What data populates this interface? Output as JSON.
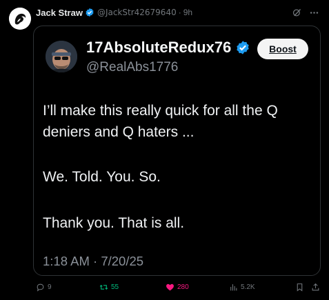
{
  "post": {
    "author_name": "Jack Straw",
    "author_handle": "@JackStr42679640",
    "separator": "·",
    "time": "9h",
    "icons": [
      "grok-icon",
      "more-icon"
    ]
  },
  "quoted": {
    "name": "17AbsoluteRedux76",
    "handle": "@RealAbs1776",
    "boost_label": "Boost",
    "lines": [
      "I’ll make this really quick for all the Q",
      "deniers and Q haters ...",
      "We. Told. You. So.",
      "Thank you. That is all."
    ],
    "timestamp": "1:18 AM · 7/20/25"
  },
  "actions": {
    "replies": "9",
    "reposts": "55",
    "likes": "280",
    "views": "5.2K"
  },
  "colors": {
    "verified": "#1d9bf0",
    "repost": "#00ba7c",
    "like": "#f91880",
    "muted": "#71767b"
  }
}
